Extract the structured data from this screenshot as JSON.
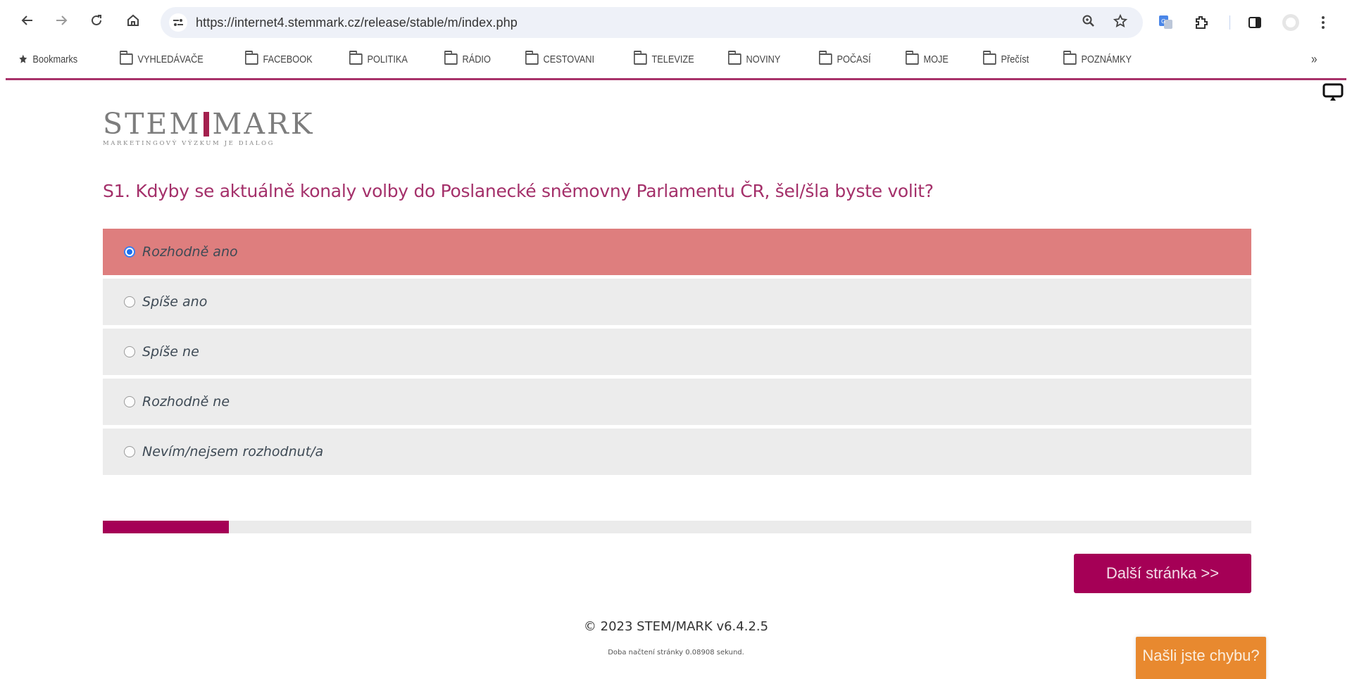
{
  "browser": {
    "url": "https://internet4.stemmark.cz/release/stable/m/index.php",
    "nav_icons": [
      "back-arrow-icon",
      "forward-arrow-icon",
      "reload-icon",
      "home-icon"
    ],
    "omnibox_icons": [
      "site-info-icon",
      "zoom-icon",
      "bookmark-star-icon"
    ],
    "toolbar_icons": [
      "google-translate-icon",
      "extensions-icon",
      "side-panel-icon",
      "profile-avatar-icon",
      "menu-icon"
    ],
    "bookmarks": [
      {
        "label": "Bookmarks",
        "icon": "star-icon"
      },
      {
        "label": "VYHLEDÁVAČE",
        "icon": "folder-icon"
      },
      {
        "label": "FACEBOOK",
        "icon": "folder-icon"
      },
      {
        "label": "POLITIKA",
        "icon": "folder-icon"
      },
      {
        "label": "RÁDIO",
        "icon": "folder-icon"
      },
      {
        "label": "CESTOVANI",
        "icon": "folder-icon"
      },
      {
        "label": "TELEVIZE",
        "icon": "folder-icon"
      },
      {
        "label": "NOVINY",
        "icon": "folder-icon"
      },
      {
        "label": "POČASÍ",
        "icon": "folder-icon"
      },
      {
        "label": "MOJE",
        "icon": "folder-icon"
      },
      {
        "label": "Přečíst",
        "icon": "folder-icon"
      },
      {
        "label": "POZNÁMKY",
        "icon": "folder-icon"
      }
    ],
    "bookmarks_overflow": "»"
  },
  "logo": {
    "left": "STEM",
    "right": "MARK",
    "tagline": "MARKETINGOVÝ VÝZKUM JE DIALOG"
  },
  "survey": {
    "question": "S1. Kdyby se aktuálně konaly volby do Poslanecké sněmovny Parlamentu ČR, šel/šla byste volit?",
    "options": [
      {
        "label": "Rozhodně ano",
        "selected": true
      },
      {
        "label": "Spíše ano",
        "selected": false
      },
      {
        "label": "Spíše ne",
        "selected": false
      },
      {
        "label": "Rozhodně ne",
        "selected": false
      },
      {
        "label": "Nevím/nejsem rozhodnut/a",
        "selected": false
      }
    ],
    "progress_fraction": 0.11,
    "next_button": "Další stránka >>"
  },
  "footer": {
    "copyright": "© 2023 STEM/MARK v6.4.2.5",
    "load_time": "Doba načtení stránky 0.08908 sekund."
  },
  "report_button": "Našli jste chybu?",
  "colors": {
    "brand": "#a50056",
    "question_text": "#a4306a",
    "selected_option": "#de7e7e",
    "option_bg": "#ececec",
    "report_button": "#e8892f"
  }
}
